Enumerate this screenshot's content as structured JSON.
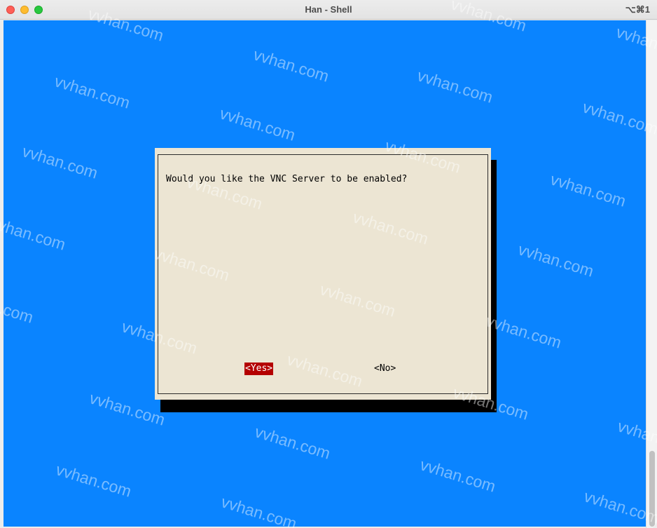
{
  "window": {
    "title": "Han - Shell",
    "shortcut": "⌥⌘1"
  },
  "terminal": {
    "background_color": "#0a84ff"
  },
  "dialog": {
    "question": "Would you like the VNC Server to be enabled?",
    "yes_label": "<Yes>",
    "no_label": "<No>",
    "selected": "Yes",
    "selected_color": "#b40000",
    "background_color": "#ece5d3"
  },
  "watermark": {
    "text": "vvhan.com"
  }
}
